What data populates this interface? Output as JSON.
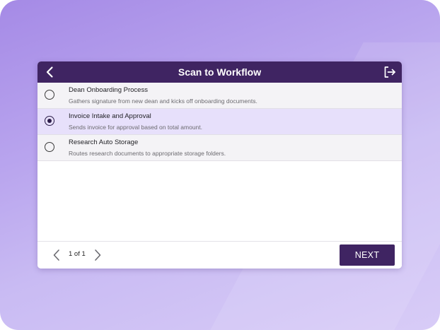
{
  "header": {
    "title": "Scan to Workflow"
  },
  "workflows": [
    {
      "name": "Dean Onboarding Process",
      "description": "Gathers signature from new dean and kicks off onboarding documents.",
      "selected": false
    },
    {
      "name": "Invoice Intake and Approval",
      "description": "Sends invoice for approval based on total amount.",
      "selected": true
    },
    {
      "name": "Research Auto Storage",
      "description": "Routes research documents to appropriate storage folders.",
      "selected": false
    }
  ],
  "pagination": {
    "label": "1 of 1"
  },
  "footer": {
    "next_label": "NEXT"
  },
  "colors": {
    "header_bg": "#3f2462",
    "selected_row_bg": "#e7e0fb",
    "row_bg": "#f4f3f6",
    "accent": "#2c1d4a"
  },
  "icons": {
    "back": "chevron-left-icon",
    "exit": "logout-icon",
    "page_prev": "chevron-left-icon",
    "page_next": "chevron-right-icon"
  }
}
